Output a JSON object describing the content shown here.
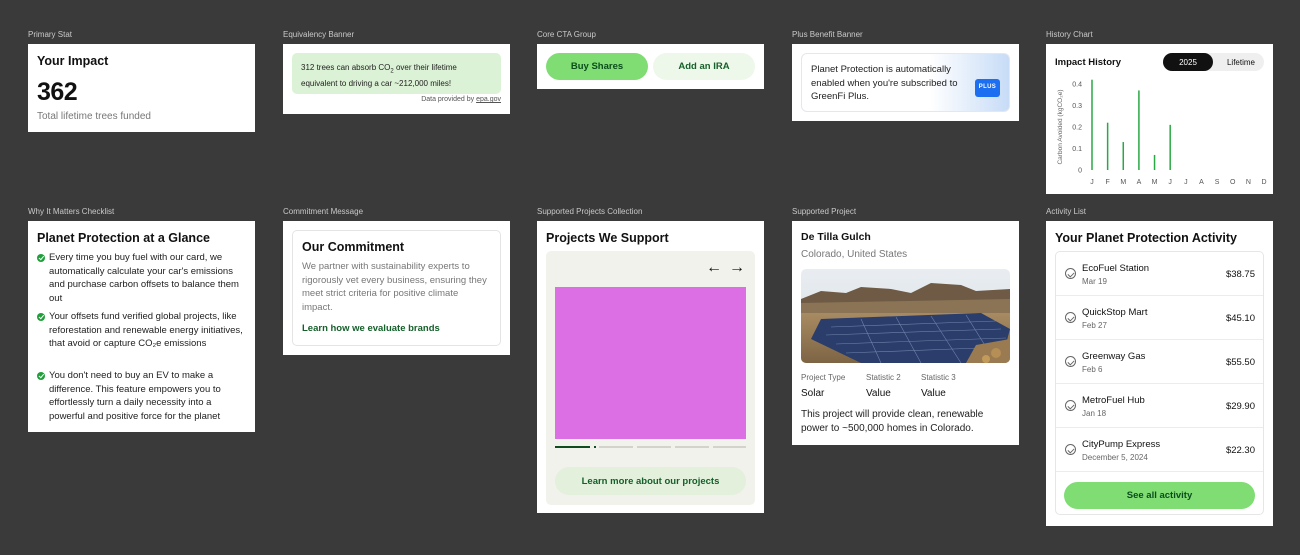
{
  "labels": {
    "primary_stat": "Primary Stat",
    "equivalency": "Equivalency Banner",
    "core_cta": "Core CTA Group",
    "plus_benefit": "Plus Benefit Banner",
    "history_chart": "History Chart",
    "checklist": "Why It Matters Checklist",
    "commitment": "Commitment Message",
    "projects_collection": "Supported Projects Collection",
    "supported_project": "Supported Project",
    "activity_list": "Activity List"
  },
  "primary_stat": {
    "title": "Your Impact",
    "value": "362",
    "subtitle": "Total lifetime trees funded"
  },
  "equivalency": {
    "line1_a": "312 trees can absorb CO",
    "line1_sub": "2",
    "line1_b": " over their lifetime",
    "line2": "equivalent to driving a car ~212,000 miles!",
    "source_prefix": "Data provided by ",
    "source_link": "epa.gov"
  },
  "cta": {
    "buy": "Buy Shares",
    "ira": "Add an IRA"
  },
  "plus_banner": {
    "text": "Planet Protection is automatically enabled when you're subscribed to GreenFi Plus.",
    "badge": "PLUS"
  },
  "history": {
    "title": "Impact History",
    "tabs": [
      "2025",
      "Lifetime"
    ],
    "active_tab": "2025"
  },
  "chart_data": {
    "type": "bar",
    "categories": [
      "J",
      "F",
      "M",
      "A",
      "M",
      "J",
      "J",
      "A",
      "S",
      "O",
      "N",
      "D"
    ],
    "values": [
      0.42,
      0.22,
      0.13,
      0.37,
      0.07,
      0.21,
      0,
      0,
      0,
      0,
      0,
      0
    ],
    "ylabel": "Carbon Avoided (kgCO₂e)",
    "yticks": [
      "0",
      "0.1",
      "0.2",
      "0.3",
      "0.4"
    ],
    "ylim": [
      0,
      0.4
    ],
    "bar_color": "#2aa845"
  },
  "checklist": {
    "title": "Planet Protection at a Glance",
    "items": [
      "Every time you buy fuel with our card, we automatically calculate your car's emissions and purchase carbon offsets to balance them out",
      "Your offsets fund verified global projects, like reforestation and renewable energy initiatives, that avoid or capture CO₂e emissions",
      "You don't need to buy an EV to make a difference. This feature empowers you to effortlessly turn a daily necessity into a powerful and positive force for the planet"
    ]
  },
  "commitment": {
    "title": "Our Commitment",
    "body": "We partner with sustainability experts to rigorously vet every business, ensuring they meet strict criteria for positive climate impact.",
    "link": "Learn how we evaluate brands"
  },
  "projects": {
    "title": "Projects We Support",
    "prev": "←",
    "next": "→",
    "button": "Learn more about our projects"
  },
  "project": {
    "name": "De Tilla Gulch",
    "location": "Colorado, United States",
    "stats": [
      {
        "label": "Project Type",
        "value": "Solar"
      },
      {
        "label": "Statistic 2",
        "value": "Value"
      },
      {
        "label": "Statistic 3",
        "value": "Value"
      }
    ],
    "description": "This project will provide clean, renewable power to ~500,000 homes in Colorado."
  },
  "activity": {
    "title": "Your Planet Protection Activity",
    "rows": [
      {
        "name": "EcoFuel Station",
        "date": "Mar 19",
        "amount": "$38.75"
      },
      {
        "name": "QuickStop Mart",
        "date": "Feb 27",
        "amount": "$45.10"
      },
      {
        "name": "Greenway Gas",
        "date": "Feb 6",
        "amount": "$55.50"
      },
      {
        "name": "MetroFuel Hub",
        "date": "Jan 18",
        "amount": "$29.90"
      },
      {
        "name": "CityPump Express",
        "date": "December 5, 2024",
        "amount": "$22.30"
      }
    ],
    "button": "See all activity"
  }
}
